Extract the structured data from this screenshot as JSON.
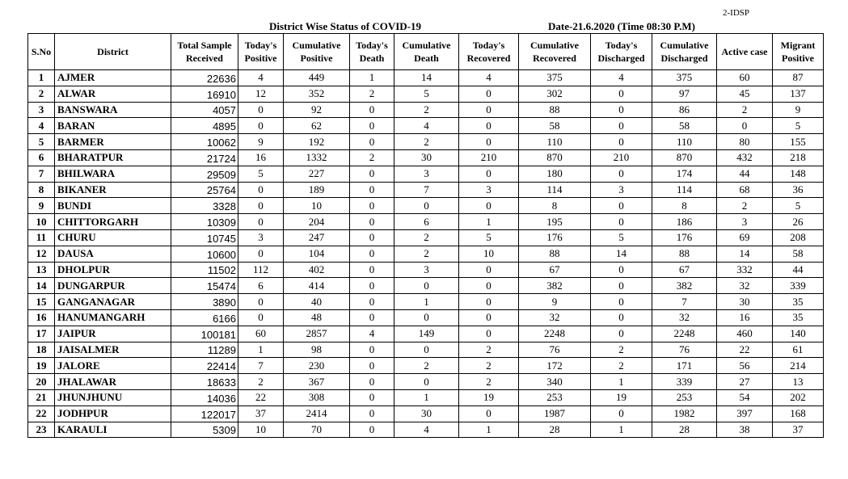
{
  "header_code": "2-IDSP",
  "title": "District Wise Status of  COVID-19",
  "date": "Date-21.6.2020 (Time 08:30 P.M)",
  "columns": [
    "S.No",
    "District",
    "Total Sample Received",
    "Today's Positive",
    "Cumulative Positive",
    "Today's Death",
    "Cumulative Death",
    "Today's Recovered",
    "Cumulative Recovered",
    "Today's Discharged",
    "Cumulative Discharged",
    "Active  case",
    "Migrant Positive"
  ],
  "rows": [
    [
      "1",
      "AJMER",
      "22636",
      "4",
      "449",
      "1",
      "14",
      "4",
      "375",
      "4",
      "375",
      "60",
      "87"
    ],
    [
      "2",
      "ALWAR",
      "16910",
      "12",
      "352",
      "2",
      "5",
      "0",
      "302",
      "0",
      "97",
      "45",
      "137"
    ],
    [
      "3",
      "BANSWARA",
      "4057",
      "0",
      "92",
      "0",
      "2",
      "0",
      "88",
      "0",
      "86",
      "2",
      "9"
    ],
    [
      "4",
      "BARAN",
      "4895",
      "0",
      "62",
      "0",
      "4",
      "0",
      "58",
      "0",
      "58",
      "0",
      "5"
    ],
    [
      "5",
      "BARMER",
      "10062",
      "9",
      "192",
      "0",
      "2",
      "0",
      "110",
      "0",
      "110",
      "80",
      "155"
    ],
    [
      "6",
      "BHARATPUR",
      "21724",
      "16",
      "1332",
      "2",
      "30",
      "210",
      "870",
      "210",
      "870",
      "432",
      "218"
    ],
    [
      "7",
      "BHILWARA",
      "29509",
      "5",
      "227",
      "0",
      "3",
      "0",
      "180",
      "0",
      "174",
      "44",
      "148"
    ],
    [
      "8",
      "BIKANER",
      "25764",
      "0",
      "189",
      "0",
      "7",
      "3",
      "114",
      "3",
      "114",
      "68",
      "36"
    ],
    [
      "9",
      "BUNDI",
      "3328",
      "0",
      "10",
      "0",
      "0",
      "0",
      "8",
      "0",
      "8",
      "2",
      "5"
    ],
    [
      "10",
      "CHITTORGARH",
      "10309",
      "0",
      "204",
      "0",
      "6",
      "1",
      "195",
      "0",
      "186",
      "3",
      "26"
    ],
    [
      "11",
      "CHURU",
      "10745",
      "3",
      "247",
      "0",
      "2",
      "5",
      "176",
      "5",
      "176",
      "69",
      "208"
    ],
    [
      "12",
      "DAUSA",
      "10600",
      "0",
      "104",
      "0",
      "2",
      "10",
      "88",
      "14",
      "88",
      "14",
      "58"
    ],
    [
      "13",
      "DHOLPUR",
      "11502",
      "112",
      "402",
      "0",
      "3",
      "0",
      "67",
      "0",
      "67",
      "332",
      "44"
    ],
    [
      "14",
      "DUNGARPUR",
      "15474",
      "6",
      "414",
      "0",
      "0",
      "0",
      "382",
      "0",
      "382",
      "32",
      "339"
    ],
    [
      "15",
      "GANGANAGAR",
      "3890",
      "0",
      "40",
      "0",
      "1",
      "0",
      "9",
      "0",
      "7",
      "30",
      "35"
    ],
    [
      "16",
      "HANUMANGARH",
      "6166",
      "0",
      "48",
      "0",
      "0",
      "0",
      "32",
      "0",
      "32",
      "16",
      "35"
    ],
    [
      "17",
      "JAIPUR",
      "100181",
      "60",
      "2857",
      "4",
      "149",
      "0",
      "2248",
      "0",
      "2248",
      "460",
      "140"
    ],
    [
      "18",
      "JAISALMER",
      "11289",
      "1",
      "98",
      "0",
      "0",
      "2",
      "76",
      "2",
      "76",
      "22",
      "61"
    ],
    [
      "19",
      "JALORE",
      "22414",
      "7",
      "230",
      "0",
      "2",
      "2",
      "172",
      "2",
      "171",
      "56",
      "214"
    ],
    [
      "20",
      "JHALAWAR",
      "18633",
      "2",
      "367",
      "0",
      "0",
      "2",
      "340",
      "1",
      "339",
      "27",
      "13"
    ],
    [
      "21",
      "JHUNJHUNU",
      "14036",
      "22",
      "308",
      "0",
      "1",
      "19",
      "253",
      "19",
      "253",
      "54",
      "202"
    ],
    [
      "22",
      "JODHPUR",
      "122017",
      "37",
      "2414",
      "0",
      "30",
      "0",
      "1987",
      "0",
      "1982",
      "397",
      "168"
    ],
    [
      "23",
      "KARAULI",
      "5309",
      "10",
      "70",
      "0",
      "4",
      "1",
      "28",
      "1",
      "28",
      "38",
      "37"
    ]
  ]
}
